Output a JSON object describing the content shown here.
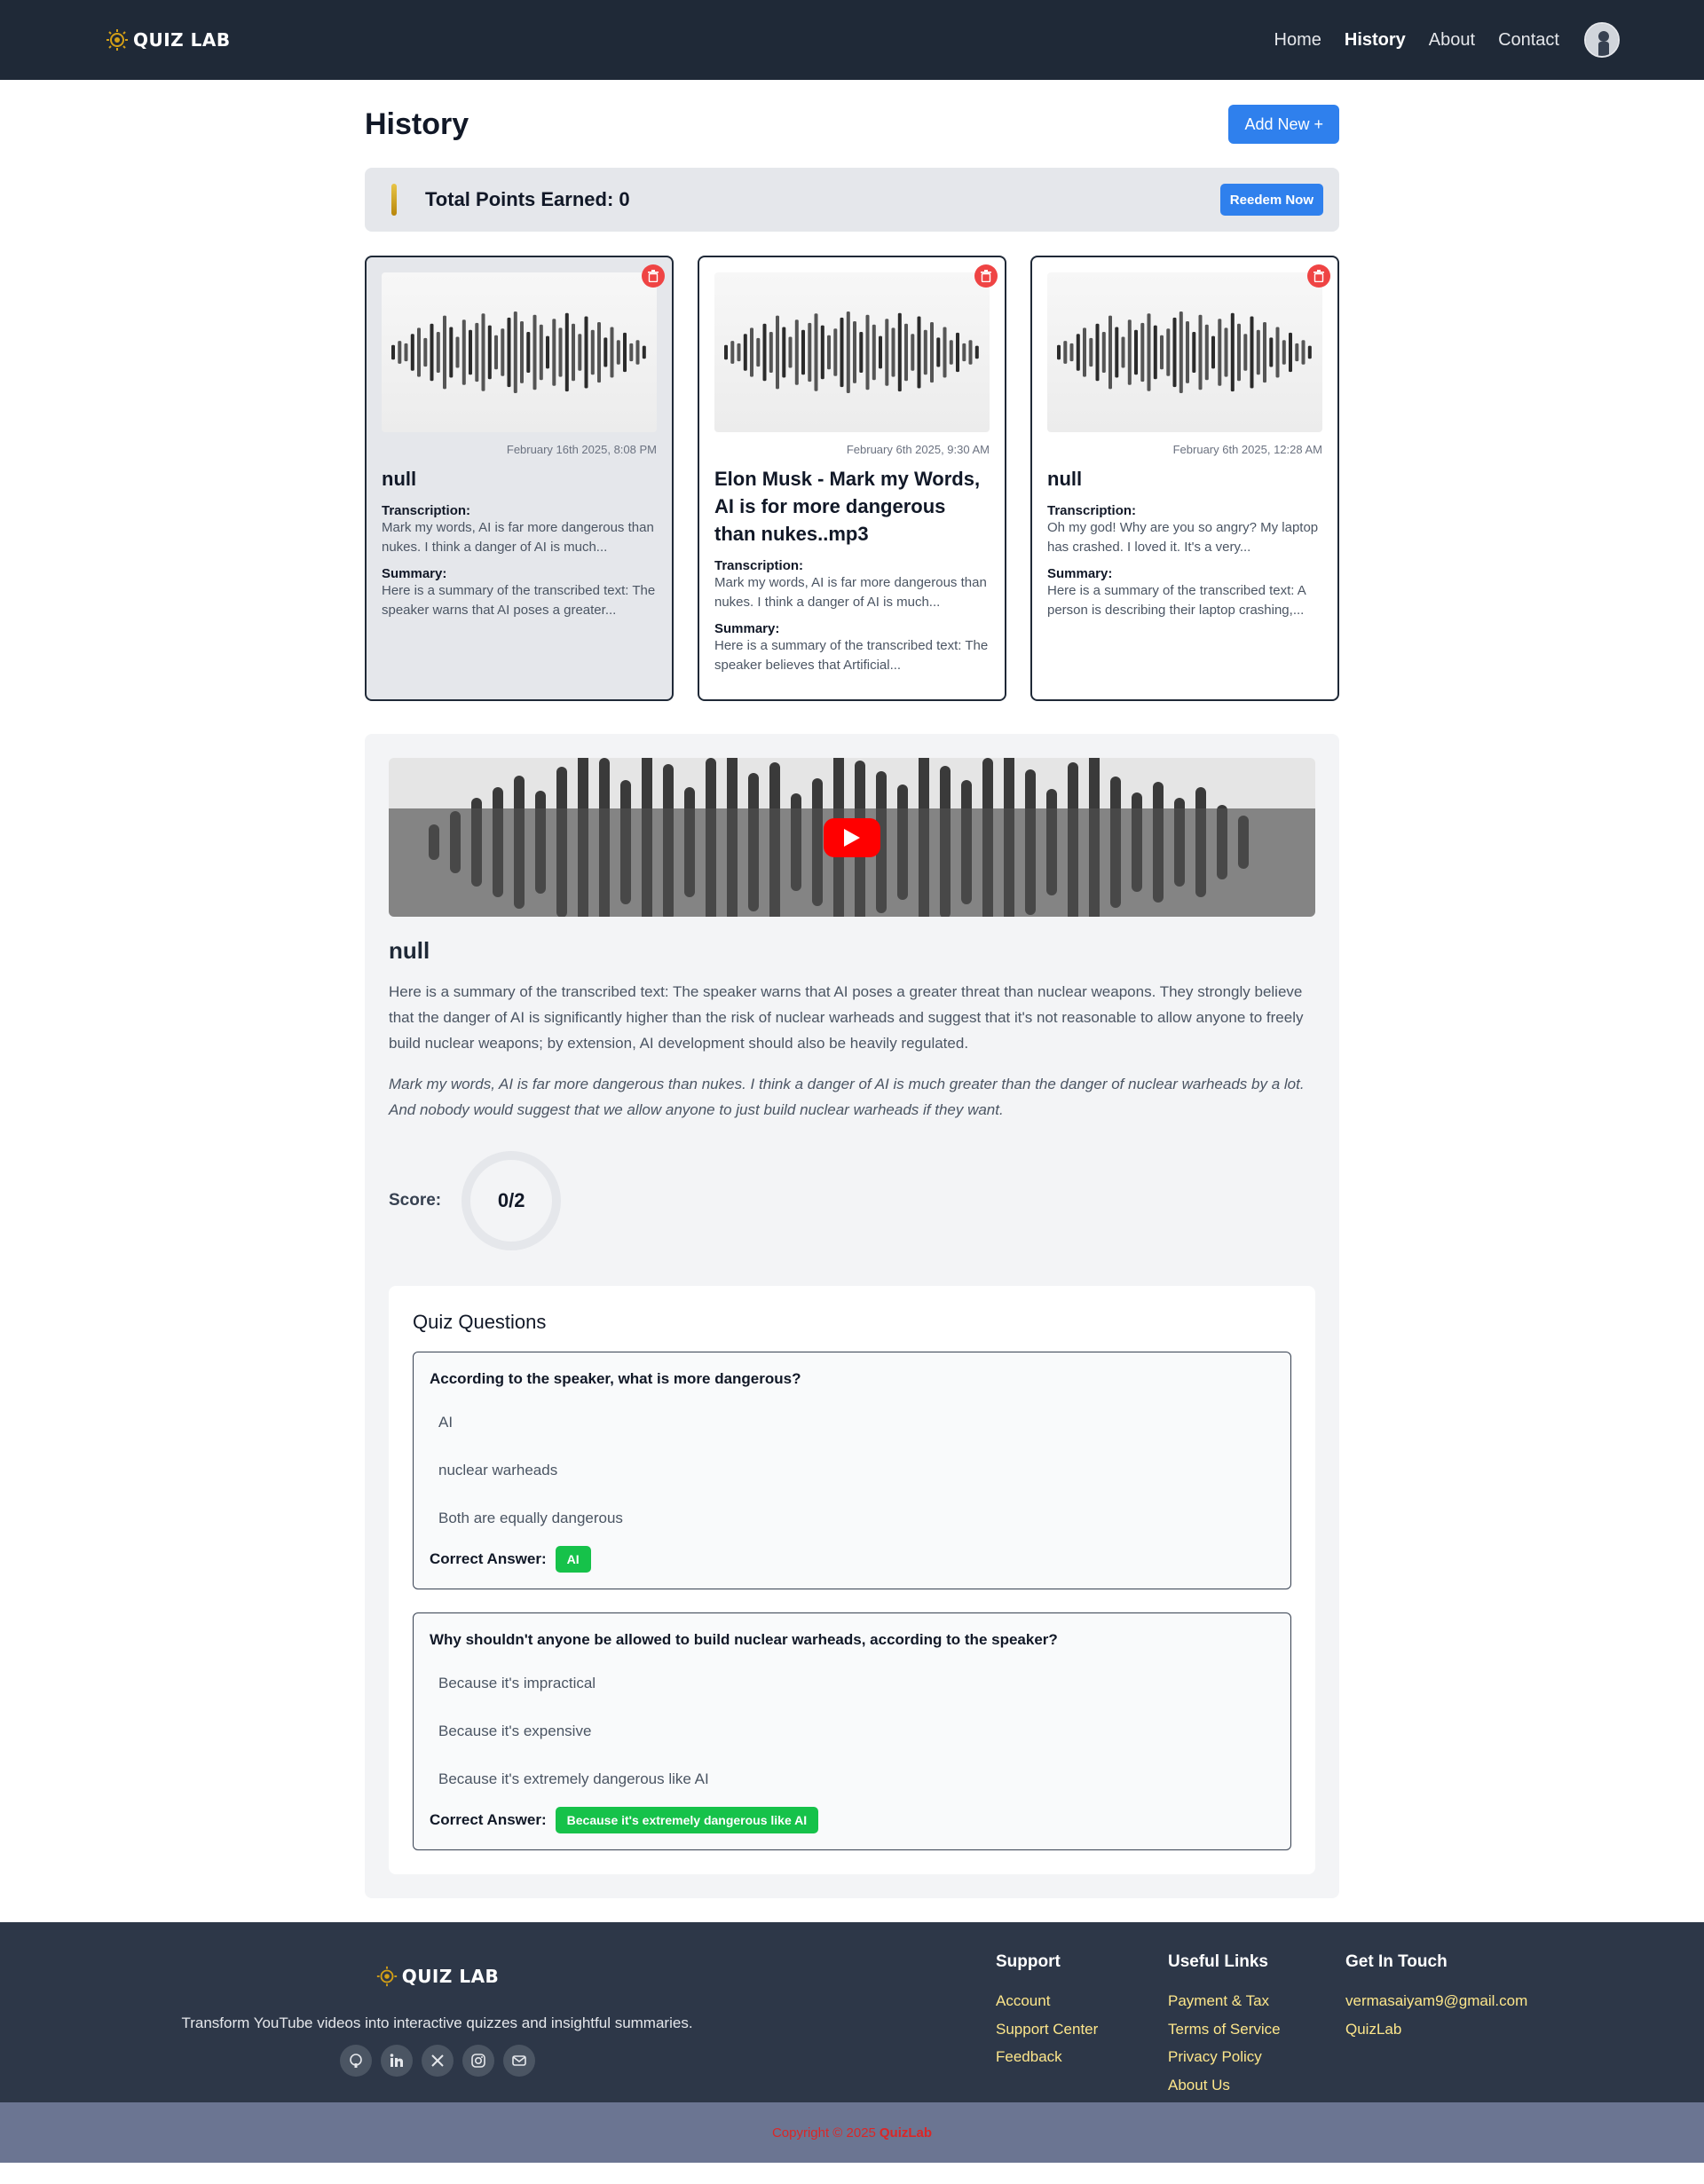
{
  "nav": {
    "brand": "QUIZ LAB",
    "links": [
      "Home",
      "History",
      "About",
      "Contact"
    ]
  },
  "page": {
    "title": "History",
    "add_button": "Add New +",
    "points_label": "Total Points Earned: 0",
    "redeem_button": "Reedem Now"
  },
  "cards": [
    {
      "date": "February 16th 2025, 8:08 PM",
      "title": "null",
      "transcription_label": "Transcription:",
      "transcription": "Mark my words, AI is far more dangerous than nukes. I think a danger of AI is much...",
      "summary_label": "Summary:",
      "summary": "Here is a summary of the transcribed text: The speaker warns that AI poses a greater..."
    },
    {
      "date": "February 6th 2025, 9:30 AM",
      "title": "Elon Musk - Mark my Words, AI is for more dangerous than nukes..mp3",
      "transcription_label": "Transcription:",
      "transcription": "Mark my words, AI is far more dangerous than nukes. I think a danger of AI is much...",
      "summary_label": "Summary:",
      "summary": "Here is a summary of the transcribed text: The speaker believes that Artificial..."
    },
    {
      "date": "February 6th 2025, 12:28 AM",
      "title": "null",
      "transcription_label": "Transcription:",
      "transcription": "Oh my god! Why are you so angry? My laptop has crashed. I loved it. It's a very...",
      "summary_label": "Summary:",
      "summary": "Here is a summary of the transcribed text: A person is describing their laptop crashing,..."
    }
  ],
  "detail": {
    "title": "null",
    "summary": "Here is a summary of the transcribed text: The speaker warns that AI poses a greater threat than nuclear weapons. They strongly believe that the danger of AI is significantly higher than the risk of nuclear warheads and suggest that it's not reasonable to allow anyone to freely build nuclear weapons; by extension, AI development should also be heavily regulated.",
    "transcription": "Mark my words, AI is far more dangerous than nukes. I think a danger of AI is much greater than the danger of nuclear warheads by a lot. And nobody would suggest that we allow anyone to just build nuclear warheads if they want.",
    "score_label": "Score:",
    "score": "0/2"
  },
  "quiz": {
    "title": "Quiz Questions",
    "answer_label": "Correct Answer:",
    "questions": [
      {
        "question": "According to the speaker, what is more dangerous?",
        "options": [
          "AI",
          "nuclear warheads",
          "Both are equally dangerous"
        ],
        "answer": "AI"
      },
      {
        "question": "Why shouldn't anyone be allowed to build nuclear warheads, according to the speaker?",
        "options": [
          "Because it's impractical",
          "Because it's expensive",
          "Because it's extremely dangerous like AI"
        ],
        "answer": "Because it's extremely dangerous like AI"
      }
    ]
  },
  "footer": {
    "brand": "QUIZ LAB",
    "tagline": "Transform YouTube videos into interactive quizzes and insightful summaries.",
    "socials": [
      "github-icon",
      "linkedin-icon",
      "x-icon",
      "instagram-icon",
      "mail-icon"
    ],
    "support": {
      "title": "Support",
      "links": [
        "Account",
        "Support Center",
        "Feedback"
      ]
    },
    "useful": {
      "title": "Useful Links",
      "links": [
        "Payment & Tax",
        "Terms of Service",
        "Privacy Policy",
        "About Us"
      ]
    },
    "contact": {
      "title": "Get In Touch",
      "links": [
        "vermasaiyam9@gmail.com",
        "QuizLab"
      ]
    },
    "copyright": "Copyright © 2025",
    "copyright_brand": "QuizLab"
  },
  "colors": {
    "nav_bg": "#1f2937",
    "accent": "#2f80ed",
    "danger": "#ef4444",
    "success": "#16c24a",
    "footer_bg": "#2d3748",
    "footer_link": "#fde68a"
  }
}
